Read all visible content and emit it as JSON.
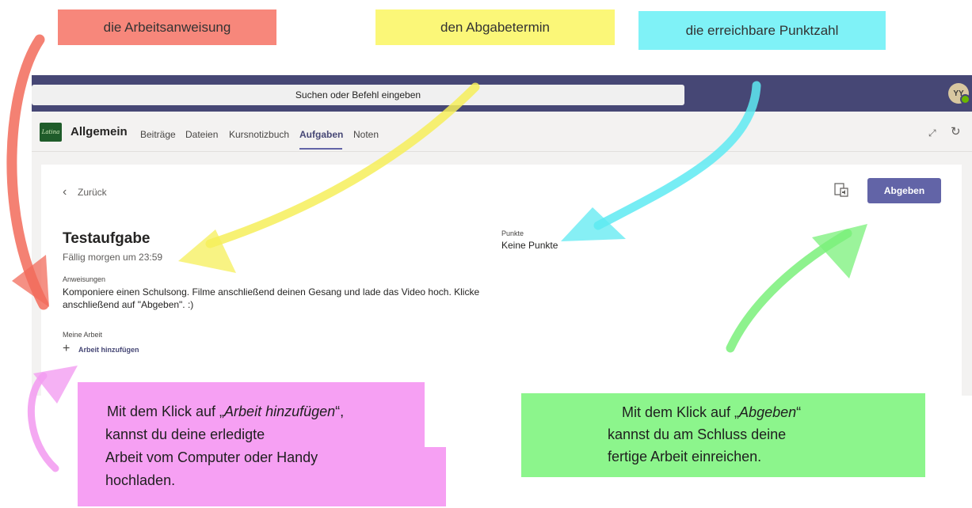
{
  "annotations": {
    "label_instructions": "die Arbeitsanweisung",
    "label_due_date": "den Abgabetermin",
    "label_points": "die erreichbare Punktzahl",
    "note_add_work": {
      "line1_prefix": "Mit dem Klick auf „",
      "line1_emph": "Arbeit hinzufügen",
      "line1_suffix": "“,",
      "line2": "kannst du deine erledigte",
      "line3": "Arbeit vom Computer oder Handy",
      "line4": "hochladen."
    },
    "note_submit": {
      "line1_prefix": "Mit dem Klick auf „",
      "line1_emph": "Abgeben",
      "line1_suffix": "“",
      "line2": "kannst du am Schluss deine",
      "line3": "fertige Arbeit einreichen."
    },
    "colors": {
      "red": "#f7877b",
      "yellow": "#fbf778",
      "cyan": "#7ff2f7",
      "pink": "#f6a0f3",
      "green": "#8cf58c"
    }
  },
  "topbar": {
    "search_placeholder": "Suchen oder Befehl eingeben",
    "avatar_initials": "YY"
  },
  "channel": {
    "logo_text": "Latina",
    "name": "Allgemein",
    "tabs": [
      "Beiträge",
      "Dateien",
      "Kursnotizbuch",
      "Aufgaben",
      "Noten"
    ],
    "active_tab": "Aufgaben"
  },
  "assignment": {
    "back_label": "Zurück",
    "submit_label": "Abgeben",
    "title": "Testaufgabe",
    "due": "Fällig morgen um 23:59",
    "instructions_label": "Anweisungen",
    "instructions_text": "Komponiere einen Schulsong. Filme anschließend deinen Gesang und lade das Video hoch. Klicke anschließend auf \"Abgeben\". :)",
    "points_label": "Punkte",
    "points_value": "Keine Punkte",
    "my_work_label": "Meine Arbeit",
    "add_work_label": "Arbeit hinzufügen"
  },
  "theme": {
    "topbar": "#464775",
    "accent": "#6264a7"
  }
}
